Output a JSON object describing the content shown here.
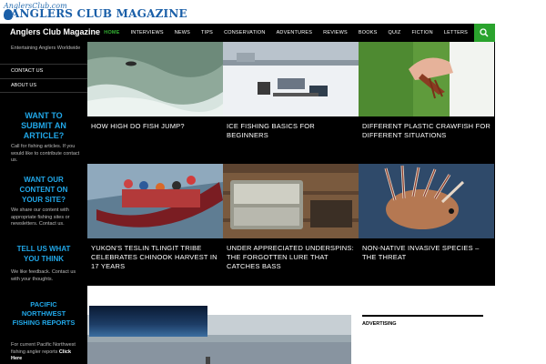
{
  "logo": {
    "sub": "AnglersClub.com",
    "main": "ANGLERS CLUB MAGAZINE"
  },
  "header": {
    "site_title": "Anglers Club Magazine",
    "nav": [
      "HOME",
      "INTERVIEWS",
      "NEWS",
      "TIPS",
      "CONSERVATION",
      "ADVENTURES",
      "REVIEWS",
      "BOOKS",
      "QUIZ",
      "FICTION",
      "LETTERS"
    ],
    "active_nav": "HOME",
    "search_icon": "search-icon"
  },
  "sidebar": {
    "tagline": "Entertaining Anglers Worldwide",
    "menu": [
      "CONTACT US",
      "ABOUT US"
    ],
    "blocks": [
      {
        "heading": "WANT TO SUBMIT AN ARTICLE?",
        "text": "Call for fishing articles. If you would like to contribute contact us."
      },
      {
        "heading": "WANT OUR CONTENT ON YOUR SITE?",
        "text": "We share our content with appropriate fishing sites or newsletters. Contact us."
      },
      {
        "heading": "TELL US WHAT YOU THINK",
        "text": "We like feedback. Contact us with your thoughts."
      },
      {
        "heading": "PACIFIC NORTHWEST FISHING REPORTS",
        "text": "For current Pacific Northwest fishing angler reports ",
        "link": "Click Here"
      }
    ]
  },
  "articles": [
    {
      "title": "HOW HIGH DO FISH JUMP?"
    },
    {
      "title": "ICE FISHING BASICS FOR BEGINNERS"
    },
    {
      "title": "DIFFERENT PLASTIC CRAWFISH FOR DIFFERENT SITUATIONS"
    },
    {
      "title": "YUKON'S TESLIN TLINGIT TRIBE CELEBRATES CHINOOK HARVEST IN 17 YEARS"
    },
    {
      "title": "UNDER APPRECIATED UNDERSPINS: THE FORGOTTEN LURE THAT CATCHES BASS"
    },
    {
      "title": "NON-NATIVE INVASIVE SPECIES – THE THREAT"
    }
  ],
  "advertising": {
    "label": "ADVERTISING"
  },
  "colors": {
    "accent": "#2aa32d",
    "heading": "#21a7e8",
    "background": "#000000"
  }
}
